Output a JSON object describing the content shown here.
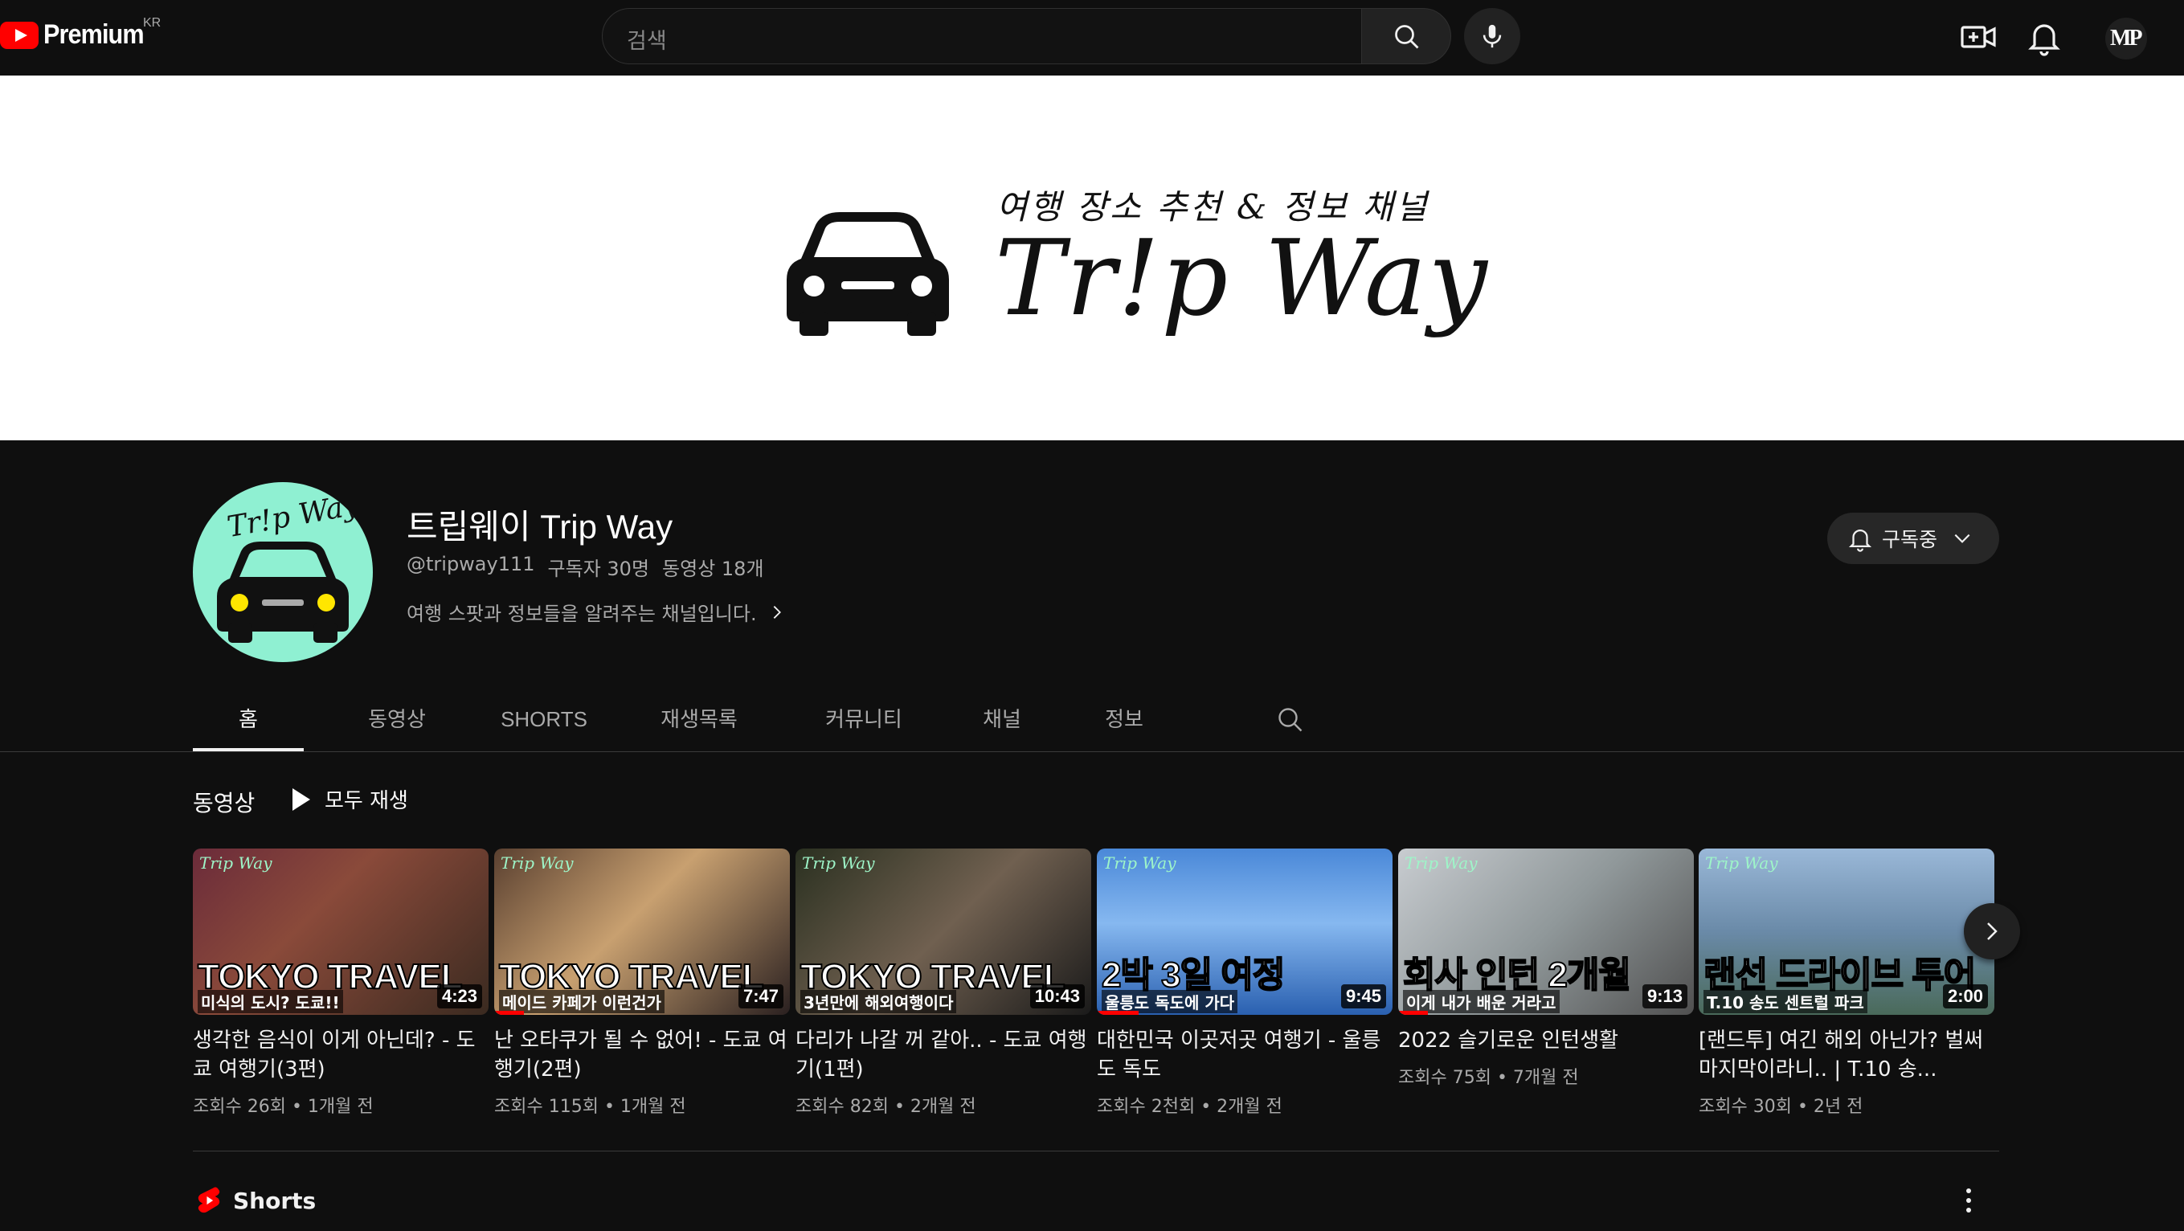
{
  "topbar": {
    "logo_text": "Premium",
    "region": "KR",
    "search_placeholder": "검색",
    "user_initials": "MP"
  },
  "banner": {
    "subtitle": "여행 장소 추천 & 정보 채널",
    "title": "Tr!p Way"
  },
  "channel": {
    "avatar_text": "Tr!p Way",
    "name": "트립웨이 Trip Way",
    "handle": "@tripway111",
    "subscribers": "구독자 30명",
    "video_count": "동영상 18개",
    "description": "여행 스팟과 정보들을 알려주는 채널입니다.",
    "subscribe_label": "구독중"
  },
  "tabs": [
    {
      "label": "홈",
      "active": true
    },
    {
      "label": "동영상"
    },
    {
      "label": "SHORTS"
    },
    {
      "label": "재생목록"
    },
    {
      "label": "커뮤니티"
    },
    {
      "label": "채널"
    },
    {
      "label": "정보"
    }
  ],
  "videos_section": {
    "title": "동영상",
    "play_all": "모두 재생"
  },
  "videos": [
    {
      "thumb_brand": "Trip Way",
      "thumb_big": "TOKYO TRAVEL",
      "thumb_small": "미식의 도시? 도쿄!!",
      "duration": "4:23",
      "progress": 0.0,
      "title": "생각한 음식이 이게 아닌데? - 도쿄 여행기(3편)",
      "views": "조회수 26회",
      "age": "1개월 전",
      "bg": "linear-gradient(135deg,#6b2b3a 0%,#8a4a3a 40%,#3a2a20 100%)"
    },
    {
      "thumb_brand": "Trip Way",
      "thumb_big": "TOKYO TRAVEL",
      "thumb_small": "메이드 카페가 이런건가",
      "duration": "7:47",
      "progress": 0.1,
      "title": "난 오타쿠가 될 수 없어! - 도쿄 여행기(2편)",
      "views": "조회수 115회",
      "age": "1개월 전",
      "bg": "linear-gradient(135deg,#5a4030 0%,#c8a070 45%,#2a2020 100%)"
    },
    {
      "thumb_brand": "Trip Way",
      "thumb_big": "TOKYO TRAVEL",
      "thumb_small": "3년만에 해외여행이다",
      "duration": "10:43",
      "progress": 0.0,
      "title": "다리가 나갈 꺼 같아.. - 도쿄 여행기(1편)",
      "views": "조회수 82회",
      "age": "2개월 전",
      "bg": "linear-gradient(135deg,#2a3020 0%,#706050 50%,#1a1a1a 100%)"
    },
    {
      "thumb_brand": "Trip Way",
      "thumb_big": "2박 3일 여정",
      "thumb_small": "울릉도 독도에 가다",
      "duration": "9:45",
      "progress": 0.14,
      "title": "대한민국 이곳저곳 여행기 - 울릉도 독도",
      "views": "조회수 2천회",
      "age": "2개월 전",
      "bg": "linear-gradient(180deg,#4a88d8 0%,#86b8f0 45%,#2a60b0 100%)"
    },
    {
      "thumb_brand": "Trip Way",
      "thumb_big": "회사 인턴 2개월",
      "thumb_small": "이게 내가 배운 거라고",
      "duration": "9:13",
      "progress": 0.1,
      "title": "2022 슬기로운 인턴생활",
      "views": "조회수 75회",
      "age": "7개월 전",
      "bg": "linear-gradient(135deg,#c8ccd0 0%,#90989a 50%,#505050 100%)"
    },
    {
      "thumb_brand": "Trip Way",
      "thumb_big": "랜선 드라이브 투어",
      "thumb_small": "T.10 송도 센트럴 파크",
      "duration": "2:00",
      "progress": 0.0,
      "title": "[랜드투] 여긴 해외 아닌가? 벌써 마지막이라니.. | T.10 송...",
      "views": "조회수 30회",
      "age": "2년 전",
      "bg": "linear-gradient(180deg,#9ab8d8 0%,#6a8aa8 50%,#4a6a5a 100%)"
    }
  ],
  "shorts": {
    "title": "Shorts"
  }
}
